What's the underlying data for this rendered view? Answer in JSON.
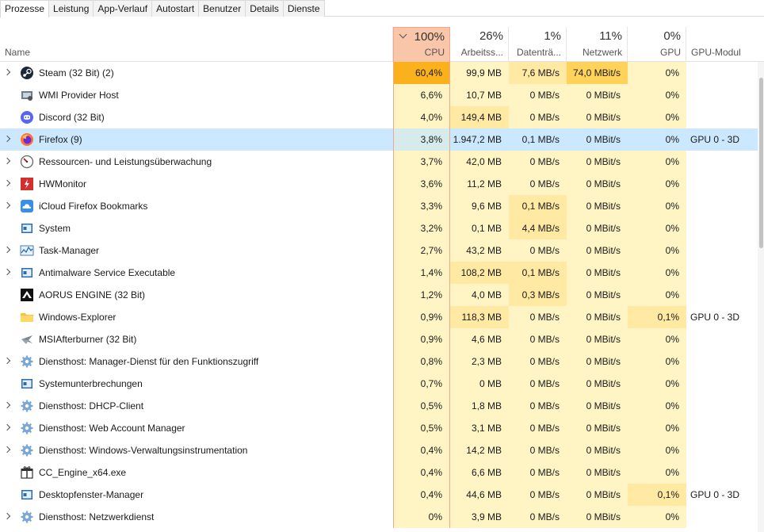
{
  "tabs": [
    "Prozesse",
    "Leistung",
    "App-Verlauf",
    "Autostart",
    "Benutzer",
    "Details",
    "Dienste"
  ],
  "active_tab": "Prozesse",
  "columns": {
    "name": {
      "label": "Name"
    },
    "cpu": {
      "pct": "100%",
      "label": "CPU"
    },
    "memory": {
      "pct": "26%",
      "label": "Arbeitss..."
    },
    "disk": {
      "pct": "1%",
      "label": "Datenträ..."
    },
    "network": {
      "pct": "11%",
      "label": "Netzwerk"
    },
    "gpu": {
      "pct": "0%",
      "label": "GPU"
    },
    "gpu_module": {
      "label": "GPU-Modul"
    }
  },
  "heat_colors": {
    "none": "#fff4c4",
    "light": "#ffe9a3",
    "high": "#ffd35a",
    "hot": "#fbb11c",
    "selected": "#cce8ff"
  },
  "processes": [
    {
      "name": "Steam (32 Bit) (2)",
      "icon": "steam-icon",
      "expandable": true,
      "cpu": "60,4%",
      "memory": "99,9 MB",
      "disk": "7,6 MB/s",
      "network": "74,0 MBit/s",
      "gpu": "0%",
      "gpu_module": "",
      "heat": {
        "cpu": "hot",
        "memory": "none",
        "disk": "light",
        "network": "high",
        "gpu": "none"
      }
    },
    {
      "name": "WMI Provider Host",
      "icon": "wmi-icon",
      "expandable": false,
      "cpu": "6,6%",
      "memory": "10,7 MB",
      "disk": "0 MB/s",
      "network": "0 MBit/s",
      "gpu": "0%",
      "gpu_module": "",
      "heat": {
        "cpu": "none",
        "memory": "none",
        "disk": "none",
        "network": "none",
        "gpu": "none"
      }
    },
    {
      "name": "Discord (32 Bit)",
      "icon": "discord-icon",
      "expandable": false,
      "cpu": "4,0%",
      "memory": "149,4 MB",
      "disk": "0 MB/s",
      "network": "0 MBit/s",
      "gpu": "0%",
      "gpu_module": "",
      "heat": {
        "cpu": "none",
        "memory": "light",
        "disk": "none",
        "network": "none",
        "gpu": "none"
      }
    },
    {
      "name": "Firefox (9)",
      "icon": "firefox-icon",
      "expandable": true,
      "selected": true,
      "cpu": "3,8%",
      "memory": "1.947,2 MB",
      "disk": "0,1 MB/s",
      "network": "0 MBit/s",
      "gpu": "0%",
      "gpu_module": "GPU 0 - 3D",
      "heat": {
        "cpu": "none",
        "memory": "none",
        "disk": "none",
        "network": "none",
        "gpu": "none"
      }
    },
    {
      "name": "Ressourcen- und Leistungsüberwachung",
      "icon": "resmon-icon",
      "expandable": true,
      "cpu": "3,7%",
      "memory": "42,0 MB",
      "disk": "0 MB/s",
      "network": "0 MBit/s",
      "gpu": "0%",
      "gpu_module": "",
      "heat": {
        "cpu": "none",
        "memory": "none",
        "disk": "none",
        "network": "none",
        "gpu": "none"
      }
    },
    {
      "name": "HWMonitor",
      "icon": "hwmonitor-icon",
      "expandable": true,
      "cpu": "3,6%",
      "memory": "11,2 MB",
      "disk": "0 MB/s",
      "network": "0 MBit/s",
      "gpu": "0%",
      "gpu_module": "",
      "heat": {
        "cpu": "none",
        "memory": "none",
        "disk": "none",
        "network": "none",
        "gpu": "none"
      }
    },
    {
      "name": "iCloud Firefox Bookmarks",
      "icon": "icloud-icon",
      "expandable": true,
      "cpu": "3,3%",
      "memory": "9,6 MB",
      "disk": "0,1 MB/s",
      "network": "0 MBit/s",
      "gpu": "0%",
      "gpu_module": "",
      "heat": {
        "cpu": "none",
        "memory": "none",
        "disk": "light",
        "network": "none",
        "gpu": "none"
      }
    },
    {
      "name": "System",
      "icon": "system-icon",
      "expandable": false,
      "cpu": "3,2%",
      "memory": "0,1 MB",
      "disk": "4,4 MB/s",
      "network": "0 MBit/s",
      "gpu": "0%",
      "gpu_module": "",
      "heat": {
        "cpu": "none",
        "memory": "none",
        "disk": "light",
        "network": "none",
        "gpu": "none"
      }
    },
    {
      "name": "Task-Manager",
      "icon": "taskmanager-icon",
      "expandable": true,
      "cpu": "2,7%",
      "memory": "43,2 MB",
      "disk": "0 MB/s",
      "network": "0 MBit/s",
      "gpu": "0%",
      "gpu_module": "",
      "heat": {
        "cpu": "none",
        "memory": "none",
        "disk": "none",
        "network": "none",
        "gpu": "none"
      }
    },
    {
      "name": "Antimalware Service Executable",
      "icon": "service-icon",
      "expandable": true,
      "cpu": "1,4%",
      "memory": "108,2 MB",
      "disk": "0,1 MB/s",
      "network": "0 MBit/s",
      "gpu": "0%",
      "gpu_module": "",
      "heat": {
        "cpu": "none",
        "memory": "light",
        "disk": "light",
        "network": "none",
        "gpu": "none"
      }
    },
    {
      "name": "AORUS ENGINE (32 Bit)",
      "icon": "aorus-icon",
      "expandable": false,
      "cpu": "1,2%",
      "memory": "4,0 MB",
      "disk": "0,3 MB/s",
      "network": "0 MBit/s",
      "gpu": "0%",
      "gpu_module": "",
      "heat": {
        "cpu": "none",
        "memory": "none",
        "disk": "light",
        "network": "none",
        "gpu": "none"
      }
    },
    {
      "name": "Windows-Explorer",
      "icon": "folder-icon",
      "expandable": false,
      "cpu": "0,9%",
      "memory": "118,3 MB",
      "disk": "0 MB/s",
      "network": "0 MBit/s",
      "gpu": "0,1%",
      "gpu_module": "GPU 0 - 3D",
      "heat": {
        "cpu": "none",
        "memory": "light",
        "disk": "none",
        "network": "none",
        "gpu": "light"
      }
    },
    {
      "name": "MSIAfterburner (32 Bit)",
      "icon": "afterburner-icon",
      "expandable": false,
      "cpu": "0,9%",
      "memory": "4,6 MB",
      "disk": "0 MB/s",
      "network": "0 MBit/s",
      "gpu": "0%",
      "gpu_module": "",
      "heat": {
        "cpu": "none",
        "memory": "none",
        "disk": "none",
        "network": "none",
        "gpu": "none"
      }
    },
    {
      "name": "Diensthost: Manager-Dienst für den Funktionszugriff",
      "icon": "gear-icon",
      "expandable": true,
      "cpu": "0,8%",
      "memory": "2,3 MB",
      "disk": "0 MB/s",
      "network": "0 MBit/s",
      "gpu": "0%",
      "gpu_module": "",
      "heat": {
        "cpu": "none",
        "memory": "none",
        "disk": "none",
        "network": "none",
        "gpu": "none"
      }
    },
    {
      "name": "Systemunterbrechungen",
      "icon": "system-icon",
      "expandable": false,
      "cpu": "0,7%",
      "memory": "0 MB",
      "disk": "0 MB/s",
      "network": "0 MBit/s",
      "gpu": "0%",
      "gpu_module": "",
      "heat": {
        "cpu": "none",
        "memory": "none",
        "disk": "none",
        "network": "none",
        "gpu": "none"
      }
    },
    {
      "name": "Diensthost: DHCP-Client",
      "icon": "gear-icon",
      "expandable": true,
      "cpu": "0,5%",
      "memory": "1,8 MB",
      "disk": "0 MB/s",
      "network": "0 MBit/s",
      "gpu": "0%",
      "gpu_module": "",
      "heat": {
        "cpu": "none",
        "memory": "none",
        "disk": "none",
        "network": "none",
        "gpu": "none"
      }
    },
    {
      "name": "Diensthost: Web Account Manager",
      "icon": "gear-icon",
      "expandable": true,
      "cpu": "0,5%",
      "memory": "3,1 MB",
      "disk": "0 MB/s",
      "network": "0 MBit/s",
      "gpu": "0%",
      "gpu_module": "",
      "heat": {
        "cpu": "none",
        "memory": "none",
        "disk": "none",
        "network": "none",
        "gpu": "none"
      }
    },
    {
      "name": "Diensthost: Windows-Verwaltungsinstrumentation",
      "icon": "gear-icon",
      "expandable": true,
      "cpu": "0,4%",
      "memory": "14,2 MB",
      "disk": "0 MB/s",
      "network": "0 MBit/s",
      "gpu": "0%",
      "gpu_module": "",
      "heat": {
        "cpu": "none",
        "memory": "none",
        "disk": "none",
        "network": "none",
        "gpu": "none"
      }
    },
    {
      "name": "CC_Engine_x64.exe",
      "icon": "gift-icon",
      "expandable": false,
      "cpu": "0,4%",
      "memory": "6,6 MB",
      "disk": "0 MB/s",
      "network": "0 MBit/s",
      "gpu": "0%",
      "gpu_module": "",
      "heat": {
        "cpu": "none",
        "memory": "none",
        "disk": "none",
        "network": "none",
        "gpu": "none"
      }
    },
    {
      "name": "Desktopfenster-Manager",
      "icon": "window-icon",
      "expandable": false,
      "cpu": "0,4%",
      "memory": "44,6 MB",
      "disk": "0 MB/s",
      "network": "0 MBit/s",
      "gpu": "0,1%",
      "gpu_module": "GPU 0 - 3D",
      "heat": {
        "cpu": "none",
        "memory": "none",
        "disk": "none",
        "network": "none",
        "gpu": "light"
      }
    },
    {
      "name": "Diensthost: Netzwerkdienst",
      "icon": "gear-icon",
      "expandable": true,
      "cpu": "0%",
      "memory": "3,9 MB",
      "disk": "0 MB/s",
      "network": "0 MBit/s",
      "gpu": "0%",
      "gpu_module": "",
      "heat": {
        "cpu": "none",
        "memory": "none",
        "disk": "none",
        "network": "none",
        "gpu": "none"
      }
    }
  ]
}
